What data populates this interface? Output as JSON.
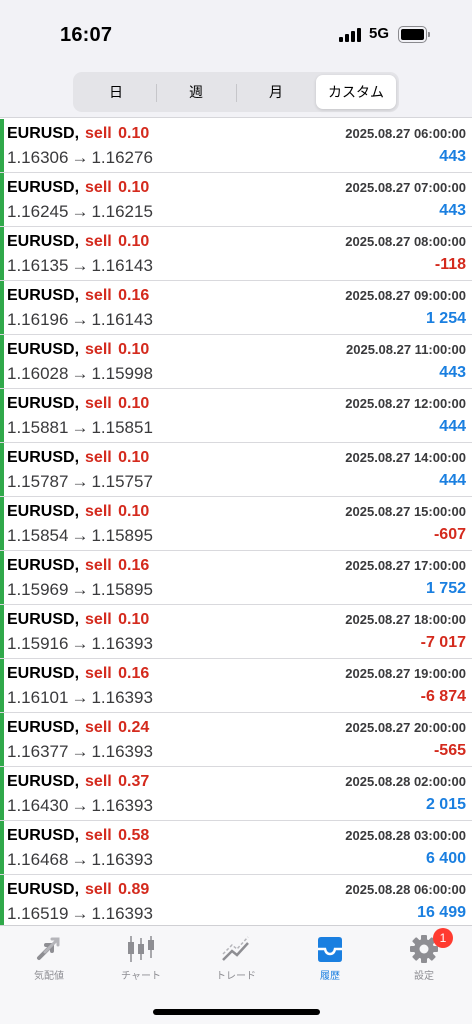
{
  "status_bar": {
    "time": "16:07",
    "network": "5G"
  },
  "period_tabs": [
    "日",
    "週",
    "月",
    "カスタム"
  ],
  "active_period": 3,
  "trades": [
    {
      "symbol": "EURUSD,",
      "type": "sell",
      "volume": "0.10",
      "time": "2025.08.27 06:00:00",
      "open_price": "1.16306",
      "close_price": "1.16276",
      "profit": "443",
      "profit_sign": "pos"
    },
    {
      "symbol": "EURUSD,",
      "type": "sell",
      "volume": "0.10",
      "time": "2025.08.27 07:00:00",
      "open_price": "1.16245",
      "close_price": "1.16215",
      "profit": "443",
      "profit_sign": "pos"
    },
    {
      "symbol": "EURUSD,",
      "type": "sell",
      "volume": "0.10",
      "time": "2025.08.27 08:00:00",
      "open_price": "1.16135",
      "close_price": "1.16143",
      "profit": "-118",
      "profit_sign": "neg"
    },
    {
      "symbol": "EURUSD,",
      "type": "sell",
      "volume": "0.16",
      "time": "2025.08.27 09:00:00",
      "open_price": "1.16196",
      "close_price": "1.16143",
      "profit": "1 254",
      "profit_sign": "pos"
    },
    {
      "symbol": "EURUSD,",
      "type": "sell",
      "volume": "0.10",
      "time": "2025.08.27 11:00:00",
      "open_price": "1.16028",
      "close_price": "1.15998",
      "profit": "443",
      "profit_sign": "pos"
    },
    {
      "symbol": "EURUSD,",
      "type": "sell",
      "volume": "0.10",
      "time": "2025.08.27 12:00:00",
      "open_price": "1.15881",
      "close_price": "1.15851",
      "profit": "444",
      "profit_sign": "pos"
    },
    {
      "symbol": "EURUSD,",
      "type": "sell",
      "volume": "0.10",
      "time": "2025.08.27 14:00:00",
      "open_price": "1.15787",
      "close_price": "1.15757",
      "profit": "444",
      "profit_sign": "pos"
    },
    {
      "symbol": "EURUSD,",
      "type": "sell",
      "volume": "0.10",
      "time": "2025.08.27 15:00:00",
      "open_price": "1.15854",
      "close_price": "1.15895",
      "profit": "-607",
      "profit_sign": "neg"
    },
    {
      "symbol": "EURUSD,",
      "type": "sell",
      "volume": "0.16",
      "time": "2025.08.27 17:00:00",
      "open_price": "1.15969",
      "close_price": "1.15895",
      "profit": "1 752",
      "profit_sign": "pos"
    },
    {
      "symbol": "EURUSD,",
      "type": "sell",
      "volume": "0.10",
      "time": "2025.08.27 18:00:00",
      "open_price": "1.15916",
      "close_price": "1.16393",
      "profit": "-7 017",
      "profit_sign": "neg"
    },
    {
      "symbol": "EURUSD,",
      "type": "sell",
      "volume": "0.16",
      "time": "2025.08.27 19:00:00",
      "open_price": "1.16101",
      "close_price": "1.16393",
      "profit": "-6 874",
      "profit_sign": "neg"
    },
    {
      "symbol": "EURUSD,",
      "type": "sell",
      "volume": "0.24",
      "time": "2025.08.27 20:00:00",
      "open_price": "1.16377",
      "close_price": "1.16393",
      "profit": "-565",
      "profit_sign": "neg"
    },
    {
      "symbol": "EURUSD,",
      "type": "sell",
      "volume": "0.37",
      "time": "2025.08.28 02:00:00",
      "open_price": "1.16430",
      "close_price": "1.16393",
      "profit": "2 015",
      "profit_sign": "pos"
    },
    {
      "symbol": "EURUSD,",
      "type": "sell",
      "volume": "0.58",
      "time": "2025.08.28 03:00:00",
      "open_price": "1.16468",
      "close_price": "1.16393",
      "profit": "6 400",
      "profit_sign": "pos"
    },
    {
      "symbol": "EURUSD,",
      "type": "sell",
      "volume": "0.89",
      "time": "2025.08.28 06:00:00",
      "open_price": "1.16519",
      "close_price": "1.16393",
      "profit": "16 499",
      "profit_sign": "pos"
    }
  ],
  "arrow_glyph": "→",
  "tab_bar": {
    "quotes": "気配値",
    "chart": "チャート",
    "trade": "トレード",
    "history": "履歴",
    "settings": "設定",
    "settings_badge": "1"
  },
  "colors": {
    "accent": "#1a7fe0",
    "sell": "#d42a1d",
    "buy_bar": "#30a94a",
    "icon_gray": "#8e8e93"
  }
}
